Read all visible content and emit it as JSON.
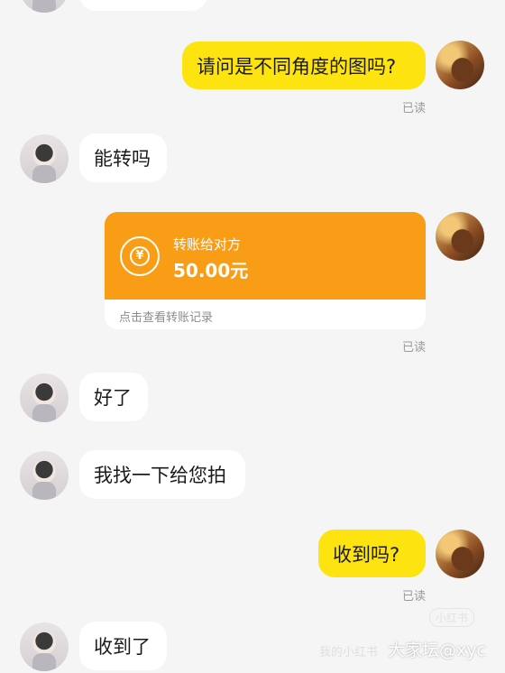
{
  "messages": {
    "m1_text": "请问是不同角度的图吗?",
    "m1_status": "已读",
    "m2_text": "能转吗",
    "m4_text": "好了",
    "m5_text": "我找一下给您拍",
    "m6_text": "收到吗?",
    "m6_status": "已读",
    "m7_text": "收到了"
  },
  "transfer": {
    "label": "转账给对方",
    "amount": "50.00元",
    "footer": "点击查看转账记录",
    "status": "已读",
    "accent": "#fa9d16"
  },
  "colors": {
    "sent_bubble": "#fde410",
    "received_bubble": "#ffffff",
    "background": "#f5f5f5"
  },
  "watermark": {
    "badge": "小红书",
    "faint": "我的小红书",
    "main": "大家坛@xyc"
  }
}
